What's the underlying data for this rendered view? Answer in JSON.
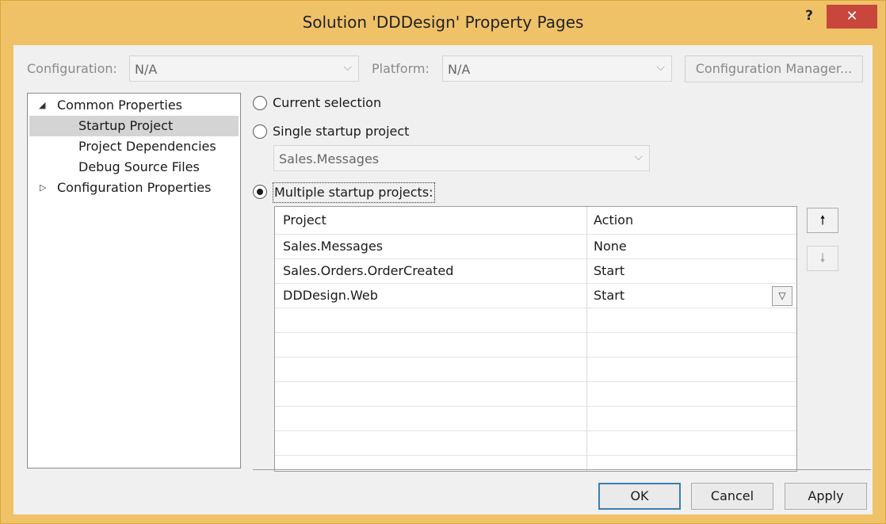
{
  "window": {
    "title": "Solution 'DDDesign' Property Pages",
    "help": "?",
    "close": "✕"
  },
  "config_bar": {
    "configuration_label": "Configuration:",
    "configuration_value": "N/A",
    "platform_label": "Platform:",
    "platform_value": "N/A",
    "config_manager_button": "Configuration Manager..."
  },
  "tree": {
    "items": [
      {
        "label": "Common Properties",
        "expander": "◢"
      },
      {
        "label": "Startup Project"
      },
      {
        "label": "Project Dependencies"
      },
      {
        "label": "Debug Source Files"
      },
      {
        "label": "Configuration Properties",
        "expander": "▷"
      }
    ]
  },
  "startup": {
    "option_current": "Current selection",
    "option_single": "Single startup project",
    "single_select_value": "Sales.Messages",
    "option_multiple": "Multiple startup projects:",
    "selected_option": "multiple"
  },
  "table": {
    "headers": [
      "Project",
      "Action"
    ],
    "rows": [
      {
        "project": "Sales.Messages",
        "action": "None"
      },
      {
        "project": "Sales.Orders.OrderCreated",
        "action": "Start"
      },
      {
        "project": "DDDesign.Web",
        "action": "Start"
      }
    ]
  },
  "move_buttons": {
    "up": "🠕",
    "down": "🠗"
  },
  "footer": {
    "ok": "OK",
    "cancel": "Cancel",
    "apply": "Apply"
  },
  "colors": {
    "title_bar": "#f0c268",
    "close_button": "#c9463d",
    "selection": "#d4d4d4"
  },
  "icons": {
    "chevron": "⌵",
    "help": "question-icon",
    "close": "close-icon"
  }
}
